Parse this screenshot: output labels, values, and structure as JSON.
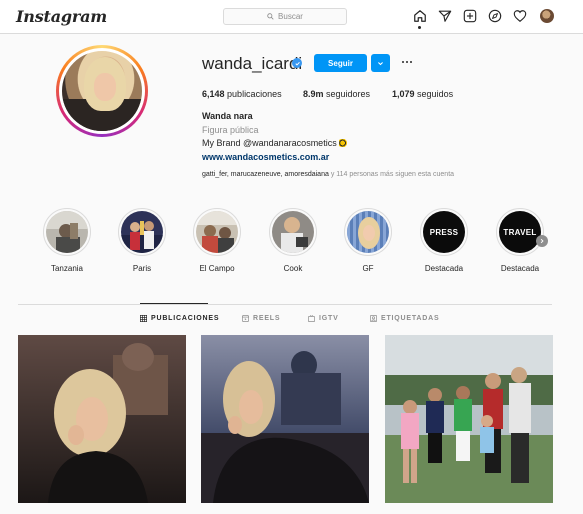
{
  "nav": {
    "logo": "Instagram",
    "search_placeholder": "Buscar"
  },
  "profile": {
    "username": "wanda_icardi",
    "follow_label": "Seguir",
    "stats": [
      {
        "value": "6,148",
        "label": "publicaciones"
      },
      {
        "value": "8.9m",
        "label": "seguidores"
      },
      {
        "value": "1,079",
        "label": "seguidos"
      }
    ],
    "full_name": "Wanda nara",
    "category": "Figura pública",
    "bio": "My Brand @wandanaracosmetics",
    "website": "www.wandacosmetics.com.ar",
    "followed_by_names": "gatti_fer, marucazeneuve, amoresdaiana",
    "followed_by_rest": "y 114 personas más siguen esta cuenta"
  },
  "highlights": [
    {
      "label": "Tanzania"
    },
    {
      "label": "Paris"
    },
    {
      "label": "El Campo"
    },
    {
      "label": "Cook"
    },
    {
      "label": "GF"
    },
    {
      "label": "Destacada",
      "cover_text": "PRESS"
    },
    {
      "label": "Destacada",
      "cover_text": "TRAVEL"
    }
  ],
  "tabs": [
    {
      "label": "PUBLICACIONES"
    },
    {
      "label": "REELS"
    },
    {
      "label": "IGTV"
    },
    {
      "label": "ETIQUETADAS"
    }
  ]
}
